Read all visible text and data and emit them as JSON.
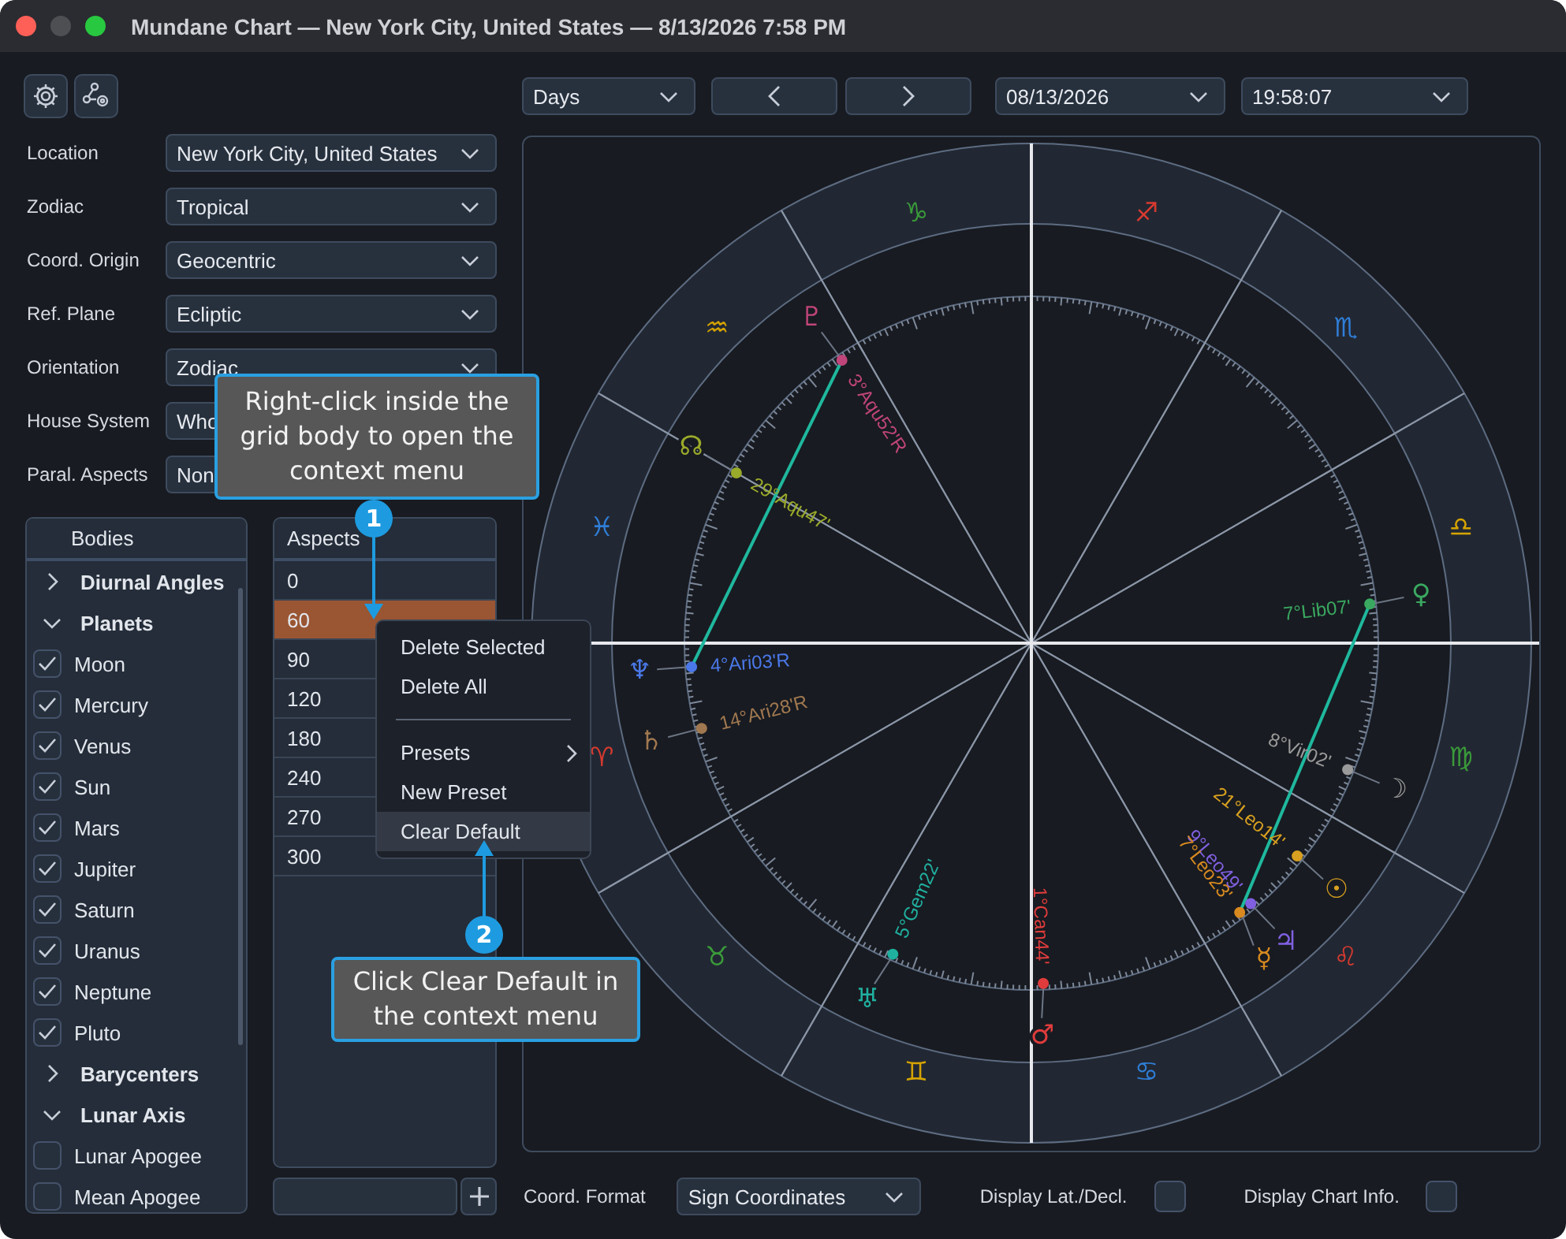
{
  "window": {
    "title": "Mundane Chart — New York City, United States — 8/13/2026 7:58 PM"
  },
  "settings": [
    {
      "label": "Location",
      "value": "New York City, United States"
    },
    {
      "label": "Zodiac",
      "value": "Tropical"
    },
    {
      "label": "Coord. Origin",
      "value": "Geocentric"
    },
    {
      "label": "Ref. Plane",
      "value": "Ecliptic"
    },
    {
      "label": "Orientation",
      "value": "Zodiac"
    },
    {
      "label": "House System",
      "value": "Who"
    },
    {
      "label": "Paral. Aspects",
      "value": "Non"
    }
  ],
  "bodies": {
    "header": "Bodies",
    "items": [
      {
        "kind": "group",
        "label": "Diurnal Angles",
        "expanded": false
      },
      {
        "kind": "group",
        "label": "Planets",
        "expanded": true,
        "children": [
          {
            "kind": "body",
            "label": "Moon",
            "checked": true
          },
          {
            "kind": "body",
            "label": "Mercury",
            "checked": true
          },
          {
            "kind": "body",
            "label": "Venus",
            "checked": true
          },
          {
            "kind": "body",
            "label": "Sun",
            "checked": true
          },
          {
            "kind": "body",
            "label": "Mars",
            "checked": true
          },
          {
            "kind": "body",
            "label": "Jupiter",
            "checked": true
          },
          {
            "kind": "body",
            "label": "Saturn",
            "checked": true
          },
          {
            "kind": "body",
            "label": "Uranus",
            "checked": true
          },
          {
            "kind": "body",
            "label": "Neptune",
            "checked": true
          },
          {
            "kind": "body",
            "label": "Pluto",
            "checked": true
          }
        ]
      },
      {
        "kind": "group",
        "label": "Barycenters",
        "expanded": false
      },
      {
        "kind": "group",
        "label": "Lunar Axis",
        "expanded": true,
        "children": [
          {
            "kind": "body",
            "label": "Lunar Apogee",
            "checked": false
          },
          {
            "kind": "body",
            "label": "Mean Apogee",
            "checked": false
          }
        ]
      }
    ]
  },
  "aspects": {
    "header": "Aspects",
    "rows": [
      {
        "value": "0",
        "selected": false
      },
      {
        "value": "60",
        "selected": true
      },
      {
        "value": "90",
        "selected": false
      },
      {
        "value": "120",
        "selected": false
      },
      {
        "value": "180",
        "selected": false
      },
      {
        "value": "240",
        "selected": false
      },
      {
        "value": "270",
        "selected": false
      },
      {
        "value": "300",
        "selected": false
      }
    ]
  },
  "context_menu": {
    "items": [
      {
        "kind": "item",
        "label": "Delete Selected",
        "highlighted": false
      },
      {
        "kind": "item",
        "label": "Delete All",
        "highlighted": false
      },
      {
        "kind": "separator"
      },
      {
        "kind": "submenu",
        "label": "Presets",
        "highlighted": false
      },
      {
        "kind": "item",
        "label": "New Preset",
        "highlighted": false
      },
      {
        "kind": "item",
        "label": "Clear Default",
        "highlighted": true
      }
    ]
  },
  "toolbar": {
    "step": "Days",
    "date": "08/13/2026",
    "time": "19:58:07"
  },
  "chart": {
    "signs": [
      {
        "glyph": "♓",
        "color": "#2f7ed8"
      },
      {
        "glyph": "♒",
        "color": "#d6a400"
      },
      {
        "glyph": "♑",
        "color": "#3a9a3a"
      },
      {
        "glyph": "♐",
        "color": "#d83a30"
      },
      {
        "glyph": "♏",
        "color": "#2f7ed8"
      },
      {
        "glyph": "♎",
        "color": "#d6a400"
      },
      {
        "glyph": "♍",
        "color": "#3a9a3a"
      },
      {
        "glyph": "♌",
        "color": "#d83a30"
      },
      {
        "glyph": "♋",
        "color": "#2f7ed8"
      },
      {
        "glyph": "♊",
        "color": "#d6a400"
      },
      {
        "glyph": "♉",
        "color": "#3a9a3a"
      },
      {
        "glyph": "♈",
        "color": "#d83a30"
      }
    ],
    "planets": [
      {
        "glyph": "♇",
        "label": "3°Aqu52'R",
        "color": "#c0457a"
      },
      {
        "glyph": "☊",
        "label": "29°Aqu47'",
        "color": "#9aaa2a"
      },
      {
        "glyph": "♀",
        "label": "7°Lib07'",
        "color": "#3aa860"
      },
      {
        "glyph": "♆",
        "label": "4°Ari03'R",
        "color": "#4a78e8"
      },
      {
        "glyph": "♄",
        "label": "14°Ari28'R",
        "color": "#a07850"
      },
      {
        "glyph": "☽",
        "label": "8°Vir02'",
        "color": "#9a9a9a"
      },
      {
        "glyph": "☉",
        "label": "21°Leo14'",
        "color": "#d8a020"
      },
      {
        "glyph": "♃",
        "label": "9°Leo49'",
        "color": "#8060e0"
      },
      {
        "glyph": "☿",
        "label": "7°Leo23'",
        "color": "#d88a20"
      },
      {
        "glyph": "♅",
        "label": "5°Gem22'",
        "color": "#20b0a0"
      },
      {
        "glyph": "♂",
        "label": "1°Can44'",
        "color": "#e03c3c"
      }
    ]
  },
  "bottom_bar": {
    "coord_format_label": "Coord. Format",
    "coord_format": "Sign Coordinates",
    "options": [
      {
        "label": "Display Lat./Decl.",
        "checked": false
      },
      {
        "label": "Display Chart Info.",
        "checked": false
      }
    ]
  },
  "callouts": [
    {
      "number": "1",
      "text": "Right-click inside the grid body to open the context menu"
    },
    {
      "number": "2",
      "text": "Click Clear Default in the context menu"
    }
  ]
}
